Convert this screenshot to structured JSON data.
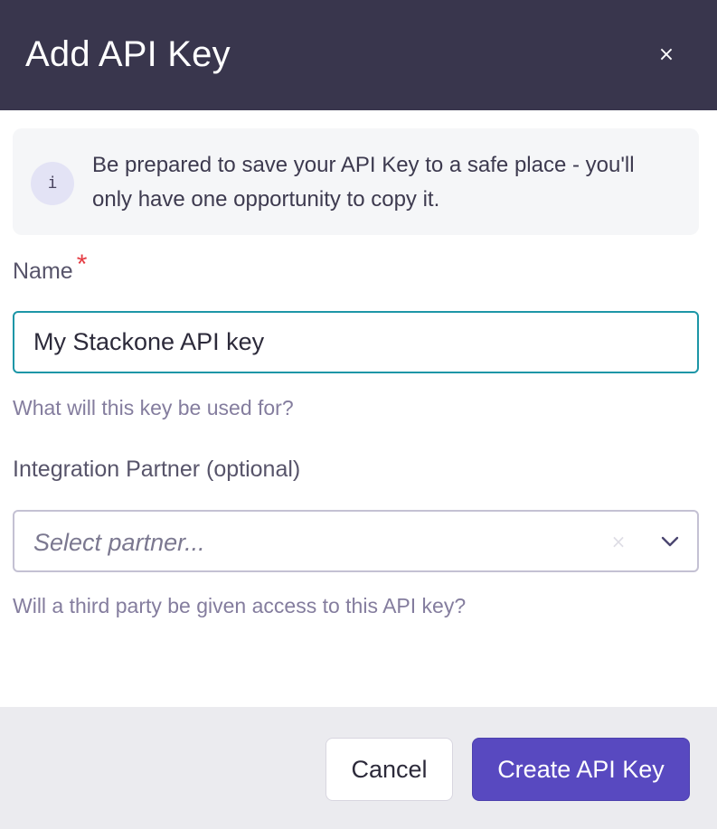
{
  "modal": {
    "title": "Add API Key",
    "close_glyph": "×"
  },
  "info": {
    "icon_glyph": "i",
    "text": "Be prepared to save your API Key to a safe place - you'll only have one opportunity to copy it."
  },
  "name_field": {
    "label": "Name",
    "required_marker": "*",
    "value": "My Stackone API key",
    "helper": "What will this key be used for?"
  },
  "partner_field": {
    "label": "Integration Partner (optional)",
    "placeholder": "Select partner...",
    "clear_glyph": "×",
    "helper": "Will a third party be given access to this API key?"
  },
  "footer": {
    "cancel_label": "Cancel",
    "create_label": "Create API Key"
  },
  "colors": {
    "header_bg": "#39364d",
    "accent": "#5849c0",
    "focus_border": "#1d96a7",
    "required": "#e53c43"
  },
  "icons": [
    "close-icon",
    "info-icon",
    "clear-icon",
    "chevron-down-icon"
  ]
}
